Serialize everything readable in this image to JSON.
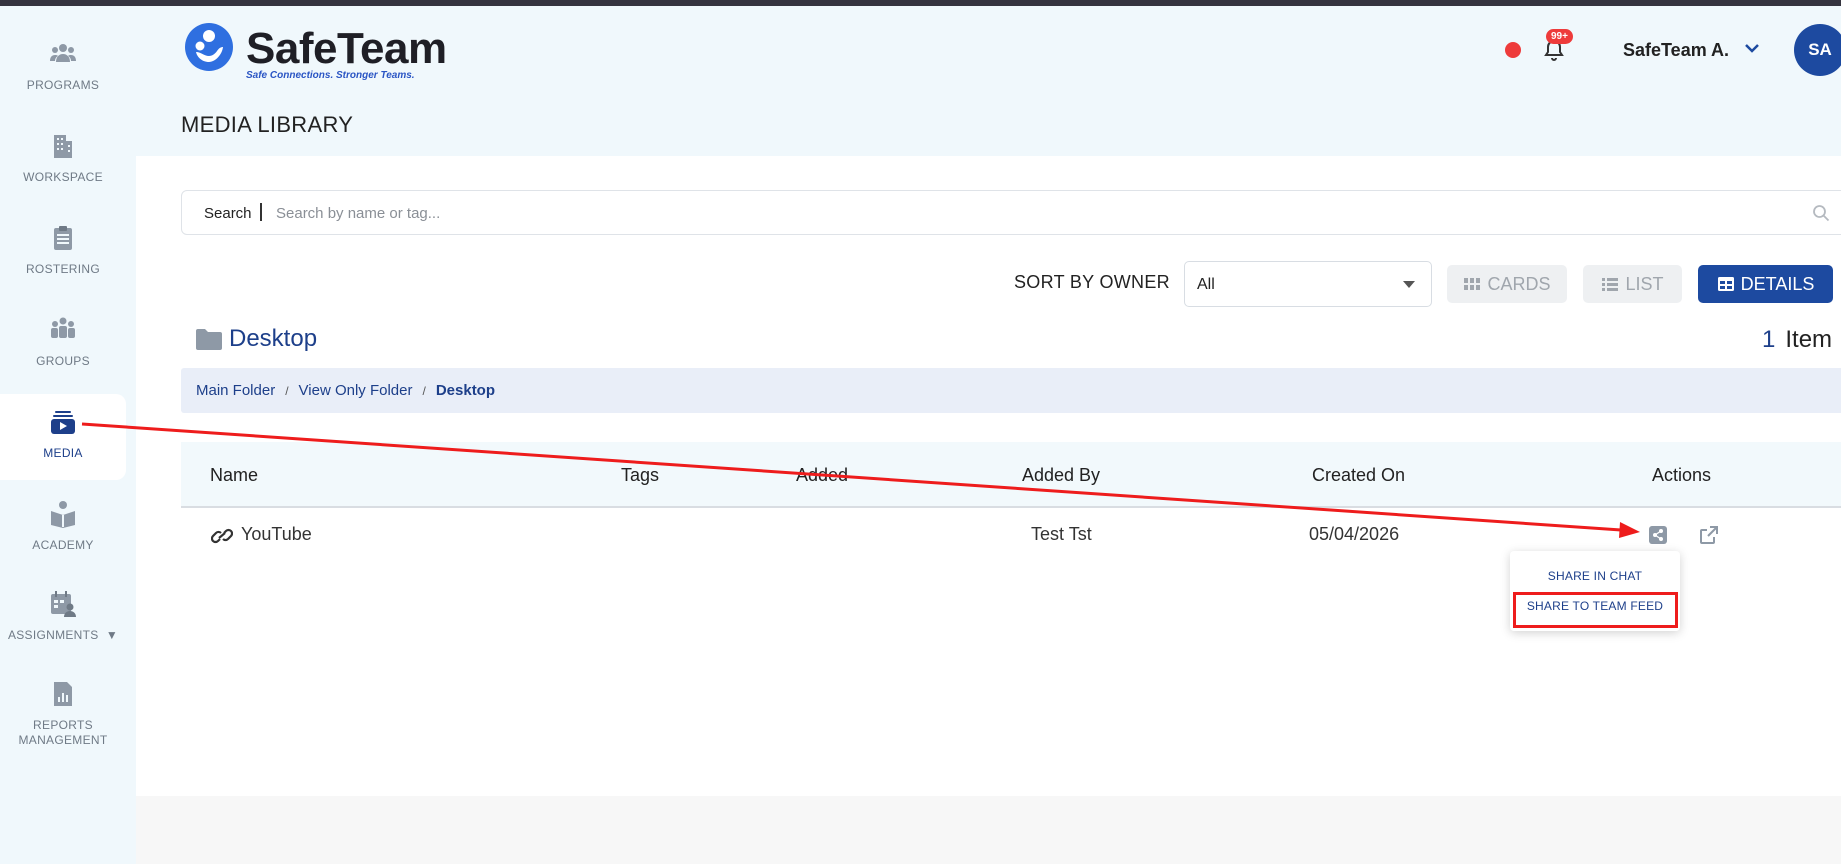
{
  "app": {
    "name": "SafeTeam",
    "tagline": "Safe Connections. Stronger Teams.",
    "accent": "#1d4aa0",
    "alert": "#ee3b3b"
  },
  "sidebar": {
    "items": [
      {
        "label": "PROGRAMS",
        "icon": "people-icon"
      },
      {
        "label": "WORKSPACE",
        "icon": "building-icon"
      },
      {
        "label": "ROSTERING",
        "icon": "clipboard-icon"
      },
      {
        "label": "GROUPS",
        "icon": "group-icon"
      },
      {
        "label": "MEDIA",
        "icon": "media-icon",
        "active": true
      },
      {
        "label": "ACADEMY",
        "icon": "book-reader-icon"
      },
      {
        "label": "ASSIGNMENTS",
        "icon": "calendar-user-icon",
        "caret": "▼"
      },
      {
        "label": "REPORTS MANAGEMENT",
        "icon": "report-icon"
      }
    ]
  },
  "header": {
    "notifications_badge": "99+",
    "user_name": "SafeTeam A.",
    "avatar_initials": "SA"
  },
  "page": {
    "title": "MEDIA LIBRARY"
  },
  "search": {
    "label": "Search",
    "placeholder": "Search by name or tag..."
  },
  "sort": {
    "label": "SORT BY OWNER",
    "value": "All"
  },
  "views": {
    "cards": "CARDS",
    "list": "LIST",
    "details": "DETAILS",
    "selected": "DETAILS"
  },
  "folder": {
    "name": "Desktop",
    "count": "1",
    "count_label": "Item"
  },
  "breadcrumb": {
    "items": [
      "Main Folder",
      "View Only Folder"
    ],
    "current": "Desktop",
    "separator": "/"
  },
  "table": {
    "columns": {
      "name": "Name",
      "tags": "Tags",
      "added": "Added",
      "added_by": "Added By",
      "created_on": "Created On",
      "actions": "Actions"
    },
    "rows": [
      {
        "name": "YouTube",
        "tags": "",
        "added": "",
        "added_by": "Test Tst",
        "created_on": "05/04/2026"
      }
    ]
  },
  "share_menu": {
    "items": [
      "SHARE IN CHAT",
      "SHARE TO TEAM FEED"
    ],
    "highlighted": "SHARE TO TEAM FEED"
  },
  "annotation_color": "#ee1c1c"
}
